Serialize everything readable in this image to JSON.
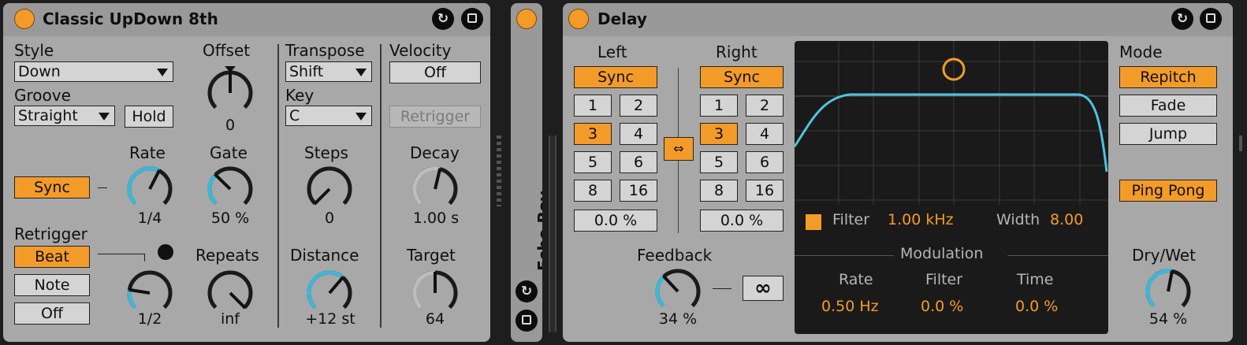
{
  "arp": {
    "title": "Classic UpDown 8th",
    "style_label": "Style",
    "style_value": "Down",
    "groove_label": "Groove",
    "groove_value": "Straight",
    "hold_label": "Hold",
    "offset_label": "Offset",
    "offset_value": "0",
    "rate_label": "Rate",
    "rate_value": "1/4",
    "rate_sync_label": "Sync",
    "gate_label": "Gate",
    "gate_value": "50 %",
    "retrigger_label": "Retrigger",
    "retrigger_options": [
      "Beat",
      "Note",
      "Off"
    ],
    "retrigger_rate_value": "1/2",
    "repeats_label": "Repeats",
    "repeats_value": "inf",
    "transpose_label": "Transpose",
    "transpose_value": "Shift",
    "key_label": "Key",
    "key_value": "C",
    "steps_label": "Steps",
    "steps_value": "0",
    "distance_label": "Distance",
    "distance_value": "+12 st",
    "velocity_label": "Velocity",
    "velocity_value": "Off",
    "vel_retrigger_label": "Retrigger",
    "decay_label": "Decay",
    "decay_value": "1.00 s",
    "target_label": "Target",
    "target_value": "64"
  },
  "rack": {
    "title": "Echo Bay"
  },
  "delay": {
    "title": "Delay",
    "left_label": "Left",
    "right_label": "Right",
    "sync_label": "Sync",
    "divisions": [
      "1",
      "2",
      "3",
      "4",
      "5",
      "6",
      "8",
      "16"
    ],
    "left_selected": "3",
    "right_selected": "3",
    "left_offset": "0.0 %",
    "right_offset": "0.0 %",
    "feedback_label": "Feedback",
    "feedback_value": "34 %",
    "freeze_symbol": "∞",
    "filter_label": "Filter",
    "filter_value": "1.00 kHz",
    "width_label": "Width",
    "width_value": "8.00",
    "modulation_label": "Modulation",
    "mod_rate_label": "Rate",
    "mod_rate_value": "0.50 Hz",
    "mod_filter_label": "Filter",
    "mod_filter_value": "0.0 %",
    "mod_time_label": "Time",
    "mod_time_value": "0.0 %",
    "mode_label": "Mode",
    "mode_options": [
      "Repitch",
      "Fade",
      "Jump"
    ],
    "mode_selected": "Repitch",
    "pingpong_label": "Ping Pong",
    "drywet_label": "Dry/Wet",
    "drywet_value": "54 %"
  },
  "icons": {
    "hotswap": "↻",
    "save": "■",
    "link": "⇔"
  },
  "colors": {
    "accent": "#f39b29",
    "knob_arc": "#3fb6d6",
    "filter_curve": "#4fc3de",
    "panel": "#a8a8a8",
    "display_bg": "#1a1a1a"
  },
  "knobs": {
    "offset": 0.5,
    "rate": 0.6,
    "gate": 0.33,
    "retrig_rate": 0.2,
    "repeats": 1.0,
    "steps": 0.0,
    "distance": 0.65,
    "decay": 0.55,
    "target": 0.5,
    "feedback": 0.34,
    "drywet": 0.54
  }
}
